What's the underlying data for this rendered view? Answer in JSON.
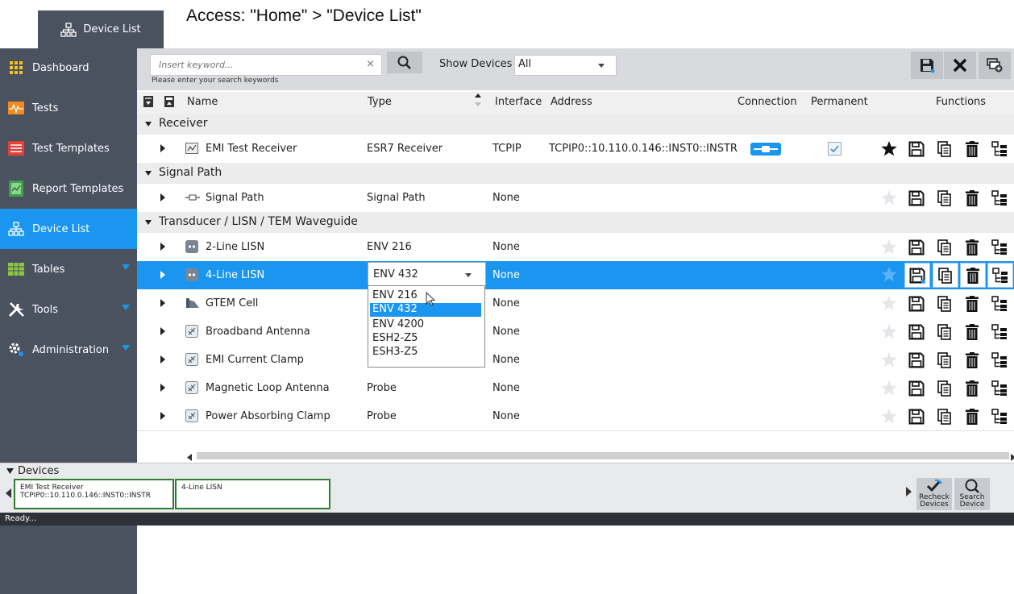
{
  "caption": "Access: \"Home\" > \"Device List\"",
  "top_tab": {
    "label": "Device List"
  },
  "sidebar": {
    "items": [
      {
        "label": "Dashboard",
        "icon": "dashboard-icon"
      },
      {
        "label": "Tests",
        "icon": "tests-icon"
      },
      {
        "label": "Test Templates",
        "icon": "test-templates-icon"
      },
      {
        "label": "Report Templates",
        "icon": "report-templates-icon"
      },
      {
        "label": "Device List",
        "icon": "device-list-icon",
        "active": true
      },
      {
        "label": "Tables",
        "icon": "tables-icon",
        "expandable": true
      },
      {
        "label": "Tools",
        "icon": "tools-icon",
        "expandable": true
      },
      {
        "label": "Administration",
        "icon": "administration-icon",
        "expandable": true
      }
    ]
  },
  "toolbar": {
    "search_placeholder": "Insert keyword...",
    "search_clear": "×",
    "search_hint": "Please enter your search keywords",
    "show_devices_label": "Show Devices",
    "show_devices_value": "All"
  },
  "columns": {
    "name": "Name",
    "type": "Type",
    "interface": "Interface",
    "address": "Address",
    "connection": "Connection",
    "permanent": "Permanent",
    "functions": "Functions"
  },
  "groups": [
    {
      "label": "Receiver"
    },
    {
      "label": "Signal Path"
    },
    {
      "label": "Transducer / LISN / TEM Waveguide"
    }
  ],
  "rows": [
    {
      "name": "EMI Test Receiver",
      "type": "ESR7 Receiver",
      "interface": "TCPIP",
      "address": "TCPIP0::10.110.0.146::INST0::INSTR",
      "favorite": true,
      "connected": true,
      "permanent": true
    },
    {
      "name": "Signal Path",
      "type": "Signal Path",
      "interface": "None",
      "address": ""
    },
    {
      "name": "2-Line LISN",
      "type": "ENV 216",
      "interface": "None",
      "address": ""
    },
    {
      "name": "4-Line LISN",
      "type": "ENV 432",
      "interface": "None",
      "address": "",
      "selected": true
    },
    {
      "name": "GTEM Cell",
      "type": "",
      "interface": "None",
      "address": ""
    },
    {
      "name": "Broadband Antenna",
      "type": "",
      "interface": "None",
      "address": ""
    },
    {
      "name": "EMI Current Clamp",
      "type": "",
      "interface": "None",
      "address": ""
    },
    {
      "name": "Magnetic Loop Antenna",
      "type": "Probe",
      "interface": "None",
      "address": ""
    },
    {
      "name": "Power Absorbing Clamp",
      "type": "Probe",
      "interface": "None",
      "address": ""
    }
  ],
  "type_dropdown": {
    "value": "ENV 432",
    "options": [
      "ENV 216",
      "ENV 432",
      "ENV 4200",
      "ESH2-Z5",
      "ESH3-Z5"
    ],
    "highlighted": "ENV 432"
  },
  "devices_panel": {
    "title": "Devices",
    "cards": [
      {
        "line1": "EMI Test Receiver",
        "line2": "TCPIP0::10.110.0.146::INST0::INSTR"
      },
      {
        "line1": "4-Line LISN",
        "line2": ""
      }
    ],
    "recheck_label_1": "Recheck",
    "recheck_label_2": "Devices",
    "search_label_1": "Search",
    "search_label_2": "Device"
  },
  "status": "Ready...",
  "colors": {
    "accent": "#1a96f0",
    "sidebar": "#4a5260",
    "card_border": "#2e7d32"
  }
}
